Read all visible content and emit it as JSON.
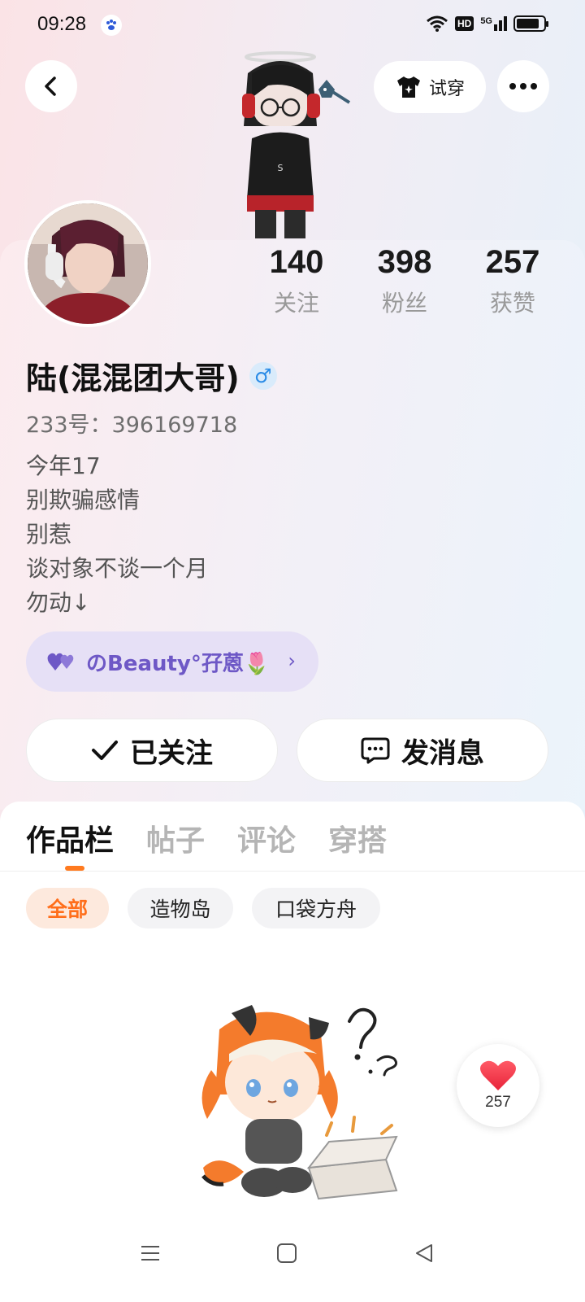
{
  "status_bar": {
    "time": "09:28",
    "network_badge": "HD",
    "signal_label": "5G",
    "battery_level": 0.85
  },
  "header": {
    "back_icon": "chevron-left-icon",
    "tryon_label": "试穿",
    "tryon_icon": "shirt-icon",
    "more_icon": "more-dots-icon"
  },
  "stats": [
    {
      "value": "140",
      "label": "关注"
    },
    {
      "value": "398",
      "label": "粉丝"
    },
    {
      "value": "257",
      "label": "获赞"
    }
  ],
  "profile": {
    "name": "陆(混混团大哥)",
    "gender_symbol": "♂",
    "id_line": "233号：396169718",
    "bio": [
      "今年17",
      "别欺骗感情",
      "别惹",
      "谈对象不谈一个月",
      "勿动↓"
    ],
    "tag_text": "のBeauty°孖蒽🌷",
    "tag_chevron": "›"
  },
  "actions": {
    "follow_label": "已关注",
    "message_label": "发消息"
  },
  "tabs": [
    "作品栏",
    "帖子",
    "评论",
    "穿搭"
  ],
  "chips": [
    "全部",
    "造物岛",
    "口袋方舟"
  ],
  "like": {
    "count": "257"
  },
  "colors": {
    "accent_orange": "#ff7a1f",
    "tag_purple": "#6e58c6",
    "gender_blue": "#2a8be6",
    "heart_red": "#f53a4c"
  }
}
